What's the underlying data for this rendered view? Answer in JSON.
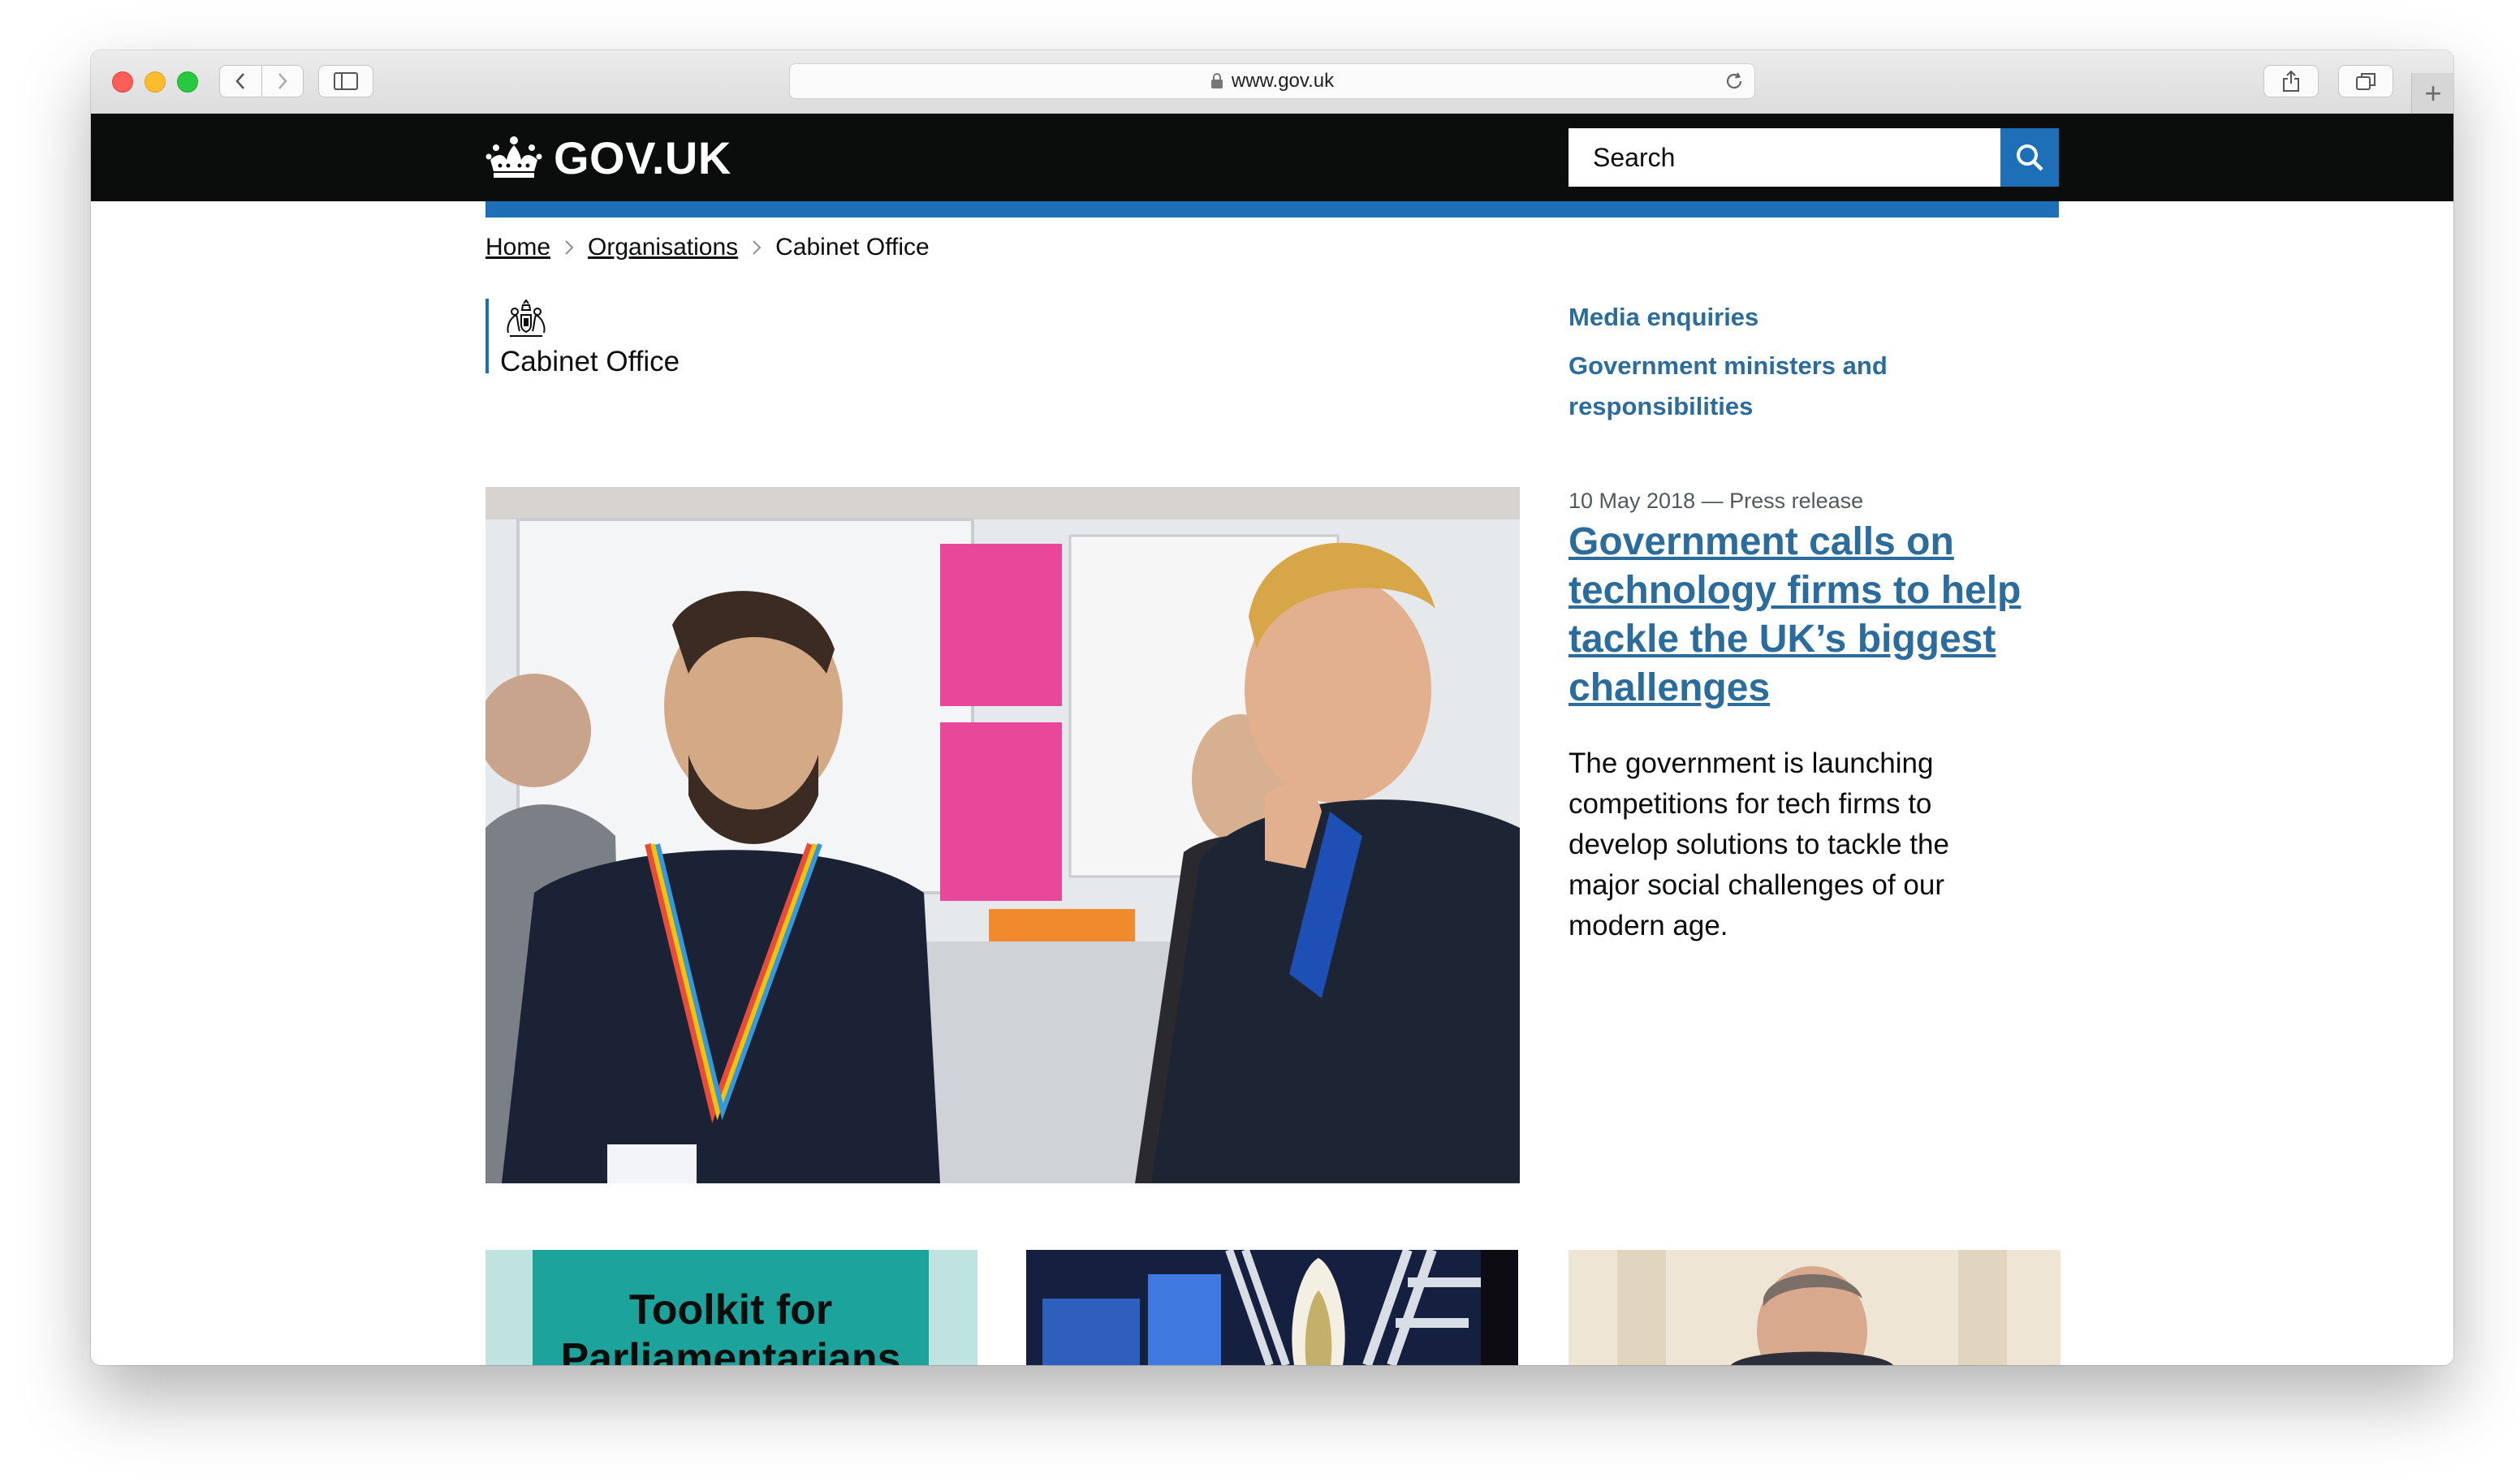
{
  "browser": {
    "url": "www.gov.uk"
  },
  "header": {
    "logo_text": "GOV.UK",
    "search_placeholder": "Search"
  },
  "breadcrumb": {
    "items": [
      "Home",
      "Organisations",
      "Cabinet Office"
    ]
  },
  "organisation": {
    "name": "Cabinet Office"
  },
  "side_links": [
    "Media enquiries",
    "Government ministers and responsibilities"
  ],
  "featured_news": {
    "meta": "10 May 2018 — Press release",
    "title": "Government calls on technology firms to help tackle the UK’s biggest challenges",
    "description": "The government is launching competitions for tech firms to develop solutions to tackle the major social challenges of our modern age."
  },
  "cards": {
    "card1_text": "Toolkit for Parliamentarians"
  },
  "colors": {
    "header_bg": "#0b0c0c",
    "accent_blue": "#1d70b8",
    "link_blue": "#2b6c9c"
  }
}
